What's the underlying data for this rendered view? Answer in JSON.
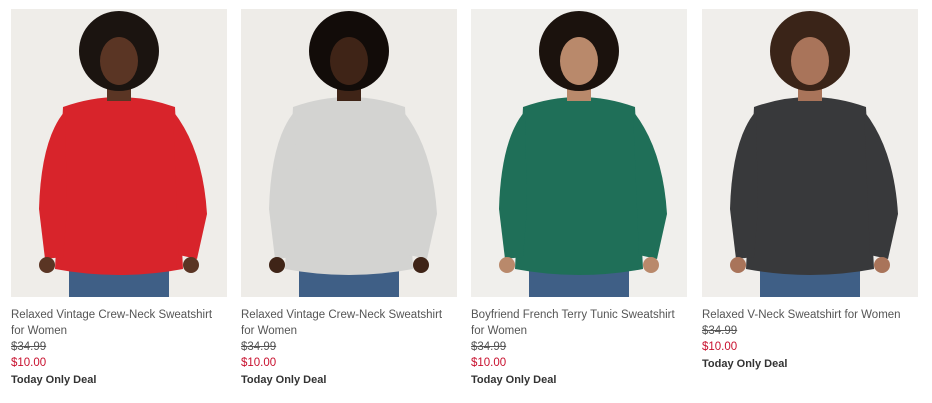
{
  "products": [
    {
      "title": "Relaxed Vintage Crew-Neck Sweatshirt for Women",
      "was_price": "$34.99",
      "sale_price": "$10.00",
      "deal_label": "Today Only Deal",
      "sweater_color": "#d8242b",
      "skin_color": "#5a3524",
      "hair_color": "#1b1410",
      "bg_color": "#efede9",
      "sale_color": "#c8102e"
    },
    {
      "title": "Relaxed Vintage Crew-Neck Sweatshirt for Women",
      "was_price": "$34.99",
      "sale_price": "$10.00",
      "deal_label": "Today Only Deal",
      "sweater_color": "#d3d3d1",
      "skin_color": "#3f2417",
      "hair_color": "#120c09",
      "bg_color": "#eeece8",
      "sale_color": "#c8102e"
    },
    {
      "title": "Boyfriend French Terry Tunic Sweatshirt for Women",
      "was_price": "$34.99",
      "sale_price": "$10.00",
      "deal_label": "Today Only Deal",
      "sweater_color": "#1f6f58",
      "skin_color": "#b9896b",
      "hair_color": "#1b120d",
      "bg_color": "#f0efec",
      "sale_color": "#c8102e"
    },
    {
      "title": "Relaxed V-Neck Sweatshirt for Women",
      "was_price": "$34.99",
      "sale_price": "$10.00",
      "deal_label": "Today Only Deal",
      "sweater_color": "#38393b",
      "skin_color": "#a9745a",
      "hair_color": "#3a2418",
      "bg_color": "#f0eeeb",
      "sale_color": "#c8102e"
    }
  ]
}
